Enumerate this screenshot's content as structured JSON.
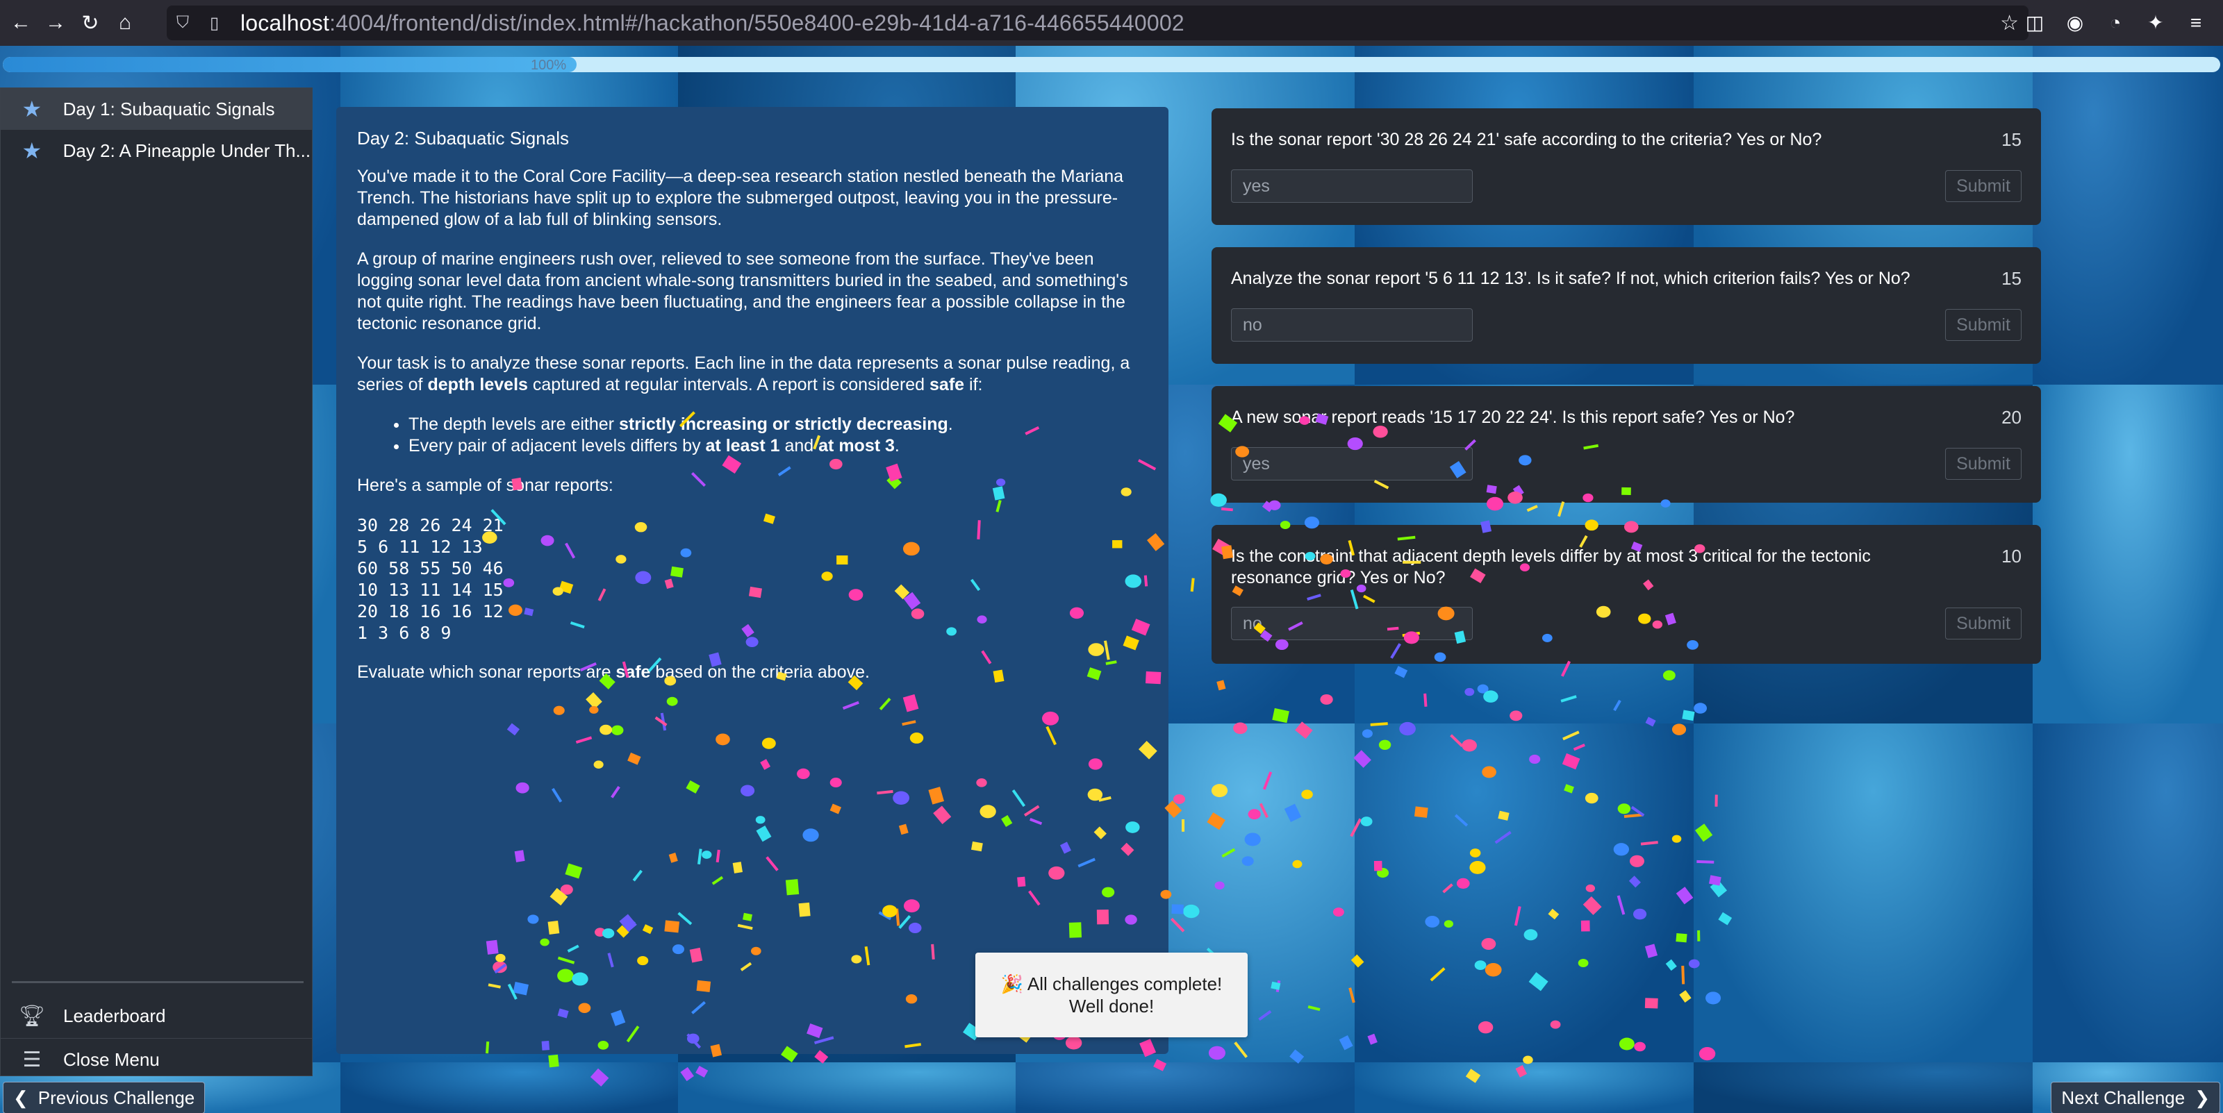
{
  "browser": {
    "url_host": "localhost",
    "url_rest": ":4004/frontend/dist/index.html#/hackathon/550e8400-e29b-41d4-a716-446655440002"
  },
  "progress": {
    "label": "100%",
    "value": 1.0
  },
  "sidebar": {
    "items": [
      {
        "label": "Day 1: Subaquatic Signals",
        "active": true
      },
      {
        "label": "Day 2: A Pineapple Under Th..."
      }
    ],
    "leaderboard_label": "Leaderboard",
    "close_menu_label": "Close Menu"
  },
  "challenge": {
    "title": "Day 2: Subaquatic Signals",
    "para1": "You've made it to the Coral Core Facility—a deep-sea research station nestled beneath the Mariana Trench. The historians have split up to explore the submerged outpost, leaving you in the pressure-dampened glow of a lab full of blinking sensors.",
    "para2": "A group of marine engineers rush over, relieved to see someone from the surface. They've been logging sonar level data from ancient whale-song transmitters buried in the seabed, and something's not quite right. The readings have been fluctuating, and the engineers fear a possible collapse in the tectonic resonance grid.",
    "para3_a": "Your task is to analyze these sonar reports. Each line in the data represents a sonar pulse reading, a series of ",
    "para3_b": "depth levels",
    "para3_c": " captured at regular intervals. A report is considered ",
    "para3_d": "safe",
    "para3_e": " if:",
    "bullet1_a": "The depth levels are either ",
    "bullet1_b": "strictly increasing or strictly decreasing",
    "bullet1_c": ".",
    "bullet2_a": "Every pair of adjacent levels differs by ",
    "bullet2_b": "at least 1",
    "bullet2_c": " and ",
    "bullet2_d": "at most 3",
    "bullet2_e": ".",
    "sample_intro": "Here's a sample of sonar reports:",
    "sample_lines": "30 28 26 24 21\n5 6 11 12 13\n60 58 55 50 46\n10 13 11 14 15\n20 18 16 16 12\n1 3 6 8 9",
    "final_a": "Evaluate which sonar reports are ",
    "final_b": "safe",
    "final_c": " based on the criteria above."
  },
  "questions": [
    {
      "text": "Is the sonar report '30 28 26 24 21' safe according to the criteria? Yes or No?",
      "points": "15",
      "answer": "yes",
      "submit": "Submit"
    },
    {
      "text": "Analyze the sonar report '5 6 11 12 13'. Is it safe? If not, which criterion fails? Yes or No?",
      "points": "15",
      "answer": "no",
      "submit": "Submit"
    },
    {
      "text": "A new sonar report reads '15 17 20 22 24'. Is this report safe? Yes or No?",
      "points": "20",
      "answer": "yes",
      "submit": "Submit"
    },
    {
      "text": "Is the constraint that adjacent depth levels differ by at most 3 critical for the tectonic resonance grid? Yes or No?",
      "points": "10",
      "answer": "no",
      "submit": "Submit"
    }
  ],
  "toast": {
    "line1": "🎉 All challenges complete!",
    "line2": "Well done!"
  },
  "footer": {
    "prev_label": "Previous Challenge",
    "next_label": "Next Challenge"
  },
  "colors": {
    "sidebar_bg": "#262b33",
    "panel_bg": "#1d4877",
    "card_bg": "#262a31",
    "accent": "#2a8ad6"
  }
}
